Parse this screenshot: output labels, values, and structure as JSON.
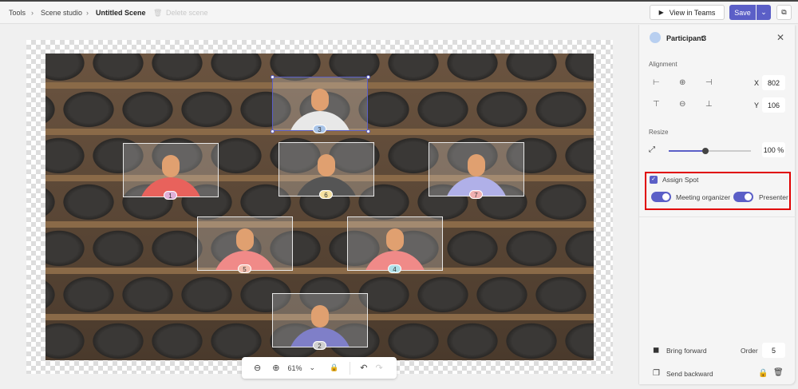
{
  "breadcrumb": {
    "items": [
      "Tools",
      "Scene studio"
    ],
    "current": "Untitled Scene",
    "delete_label": "Delete scene"
  },
  "header": {
    "view_in_teams": "View in Teams",
    "save": "Save"
  },
  "colors": {
    "accent": "#5b5fc7",
    "highlight": "#e00000"
  },
  "participants": [
    {
      "number": "3",
      "selected": true,
      "badge_color": "#a8c4e8",
      "body_color": "#e8e8e8"
    },
    {
      "number": "1",
      "badge_color": "#e0b0d8",
      "body_color": "#e8625c"
    },
    {
      "number": "6",
      "badge_color": "#f5e0a0",
      "body_color": "#555"
    },
    {
      "number": "7",
      "badge_color": "#f0b0b0",
      "body_color": "#b0b0e8"
    },
    {
      "number": "5",
      "badge_color": "#f5c0b0",
      "body_color": "#f08a88"
    },
    {
      "number": "4",
      "badge_color": "#b0e0e8",
      "body_color": "#f08a88"
    },
    {
      "number": "2",
      "badge_color": "#d0d0d0",
      "body_color": "#7f7fc8"
    }
  ],
  "zoom": {
    "level": "61%"
  },
  "panel": {
    "title": "Participant",
    "participant_number": "3",
    "alignment_label": "Alignment",
    "x_label": "X",
    "x_value": "802",
    "y_label": "Y",
    "y_value": "106",
    "resize_label": "Resize",
    "resize_value": "100 %",
    "resize_fraction": 0.45,
    "assign_spot_label": "Assign Spot",
    "assign_spot_checked": true,
    "meeting_organizer_label": "Meeting organizer",
    "presenter_label": "Presenter",
    "bring_forward": "Bring forward",
    "send_backward": "Send backward",
    "order_label": "Order",
    "order_value": "5"
  }
}
